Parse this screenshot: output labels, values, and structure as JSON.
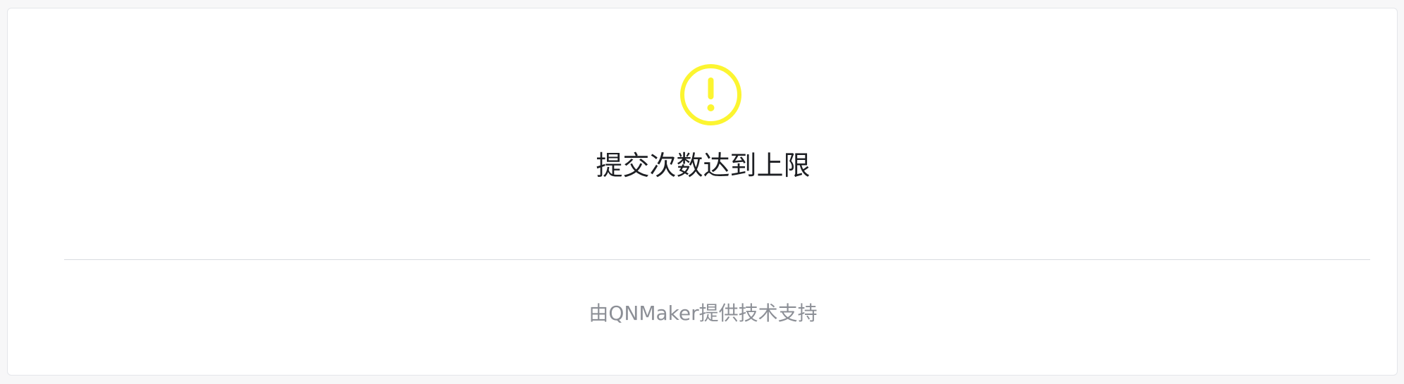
{
  "status": {
    "icon": "exclamation-circle-icon",
    "icon_color": "#fcf530",
    "title": "提交次数达到上限"
  },
  "footer": {
    "text": "由QNMaker提供技术支持"
  }
}
